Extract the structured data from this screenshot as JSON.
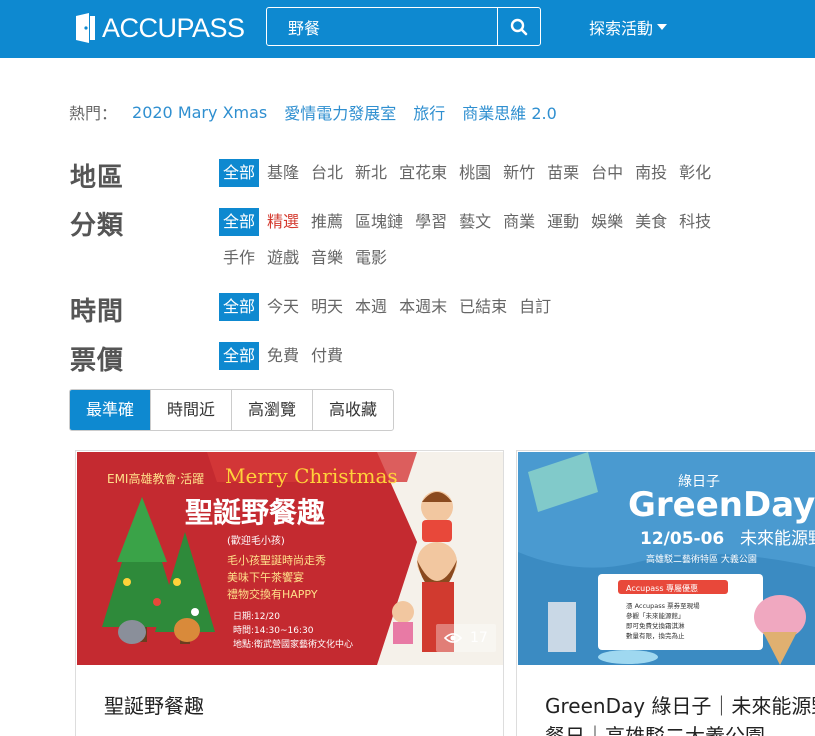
{
  "brand": {
    "name": "ACCUPASS"
  },
  "search": {
    "value": "野餐"
  },
  "nav": {
    "explore": "探索活動"
  },
  "hot": {
    "label": "熱門：",
    "links": [
      "2020 Mary Xmas",
      "愛情電力發展室",
      "旅行",
      "商業思維 2.0"
    ]
  },
  "filters": {
    "region": {
      "title": "地區",
      "options": [
        "全部",
        "基隆",
        "台北",
        "新北",
        "宜花東",
        "桃園",
        "新竹",
        "苗栗",
        "台中",
        "南投",
        "彰化"
      ]
    },
    "category": {
      "title": "分類",
      "options": [
        "全部",
        "精選",
        "推薦",
        "區塊鏈",
        "學習",
        "藝文",
        "商業",
        "運動",
        "娛樂",
        "美食",
        "科技"
      ],
      "options2": [
        "手作",
        "遊戲",
        "音樂",
        "電影"
      ]
    },
    "time": {
      "title": "時間",
      "options": [
        "全部",
        "今天",
        "明天",
        "本週",
        "本週末",
        "已結束",
        "自訂"
      ]
    },
    "price": {
      "title": "票價",
      "options": [
        "全部",
        "免費",
        "付費"
      ]
    }
  },
  "sort": {
    "tabs": [
      "最準確",
      "時間近",
      "高瀏覽",
      "高收藏"
    ]
  },
  "cards": [
    {
      "title": "聖誕野餐趣",
      "views": "17",
      "poster": {
        "org": "EMI高雄教會‧活躍",
        "banner": "Merry Christmas",
        "headline": "聖誕野餐趣",
        "welcome": "(歡迎毛小孩)",
        "bullets": [
          "毛小孩聖誕時尚走秀",
          "美味下午茶饗宴",
          "禮物交換有HAPPY"
        ],
        "date": "日期:12/20",
        "time": "時間:14:30~16:30",
        "place": "地點:衛武營國家藝術文化中心"
      }
    },
    {
      "title": "GreenDay 綠日子｜未來能源野餐日｜高雄駁二大義公園",
      "poster": {
        "small": "綠日子",
        "big": "GreenDay",
        "dates": "12/05-06",
        "tagline": "未來能源野餐",
        "venue": "高雄駁二藝術特區 大義公園",
        "promo": "Accupass 專屬優惠",
        "promo_lines": [
          "憑 Accupass 票券至現場",
          "參觀「未來能源館」",
          "即可免費兌換霜淇淋",
          "數量有限，換完為止"
        ]
      }
    }
  ],
  "colors": {
    "header": "#0e89d0",
    "link": "#2f8fd0",
    "active": "#0e89d0",
    "highlight": "#d43a2f"
  }
}
